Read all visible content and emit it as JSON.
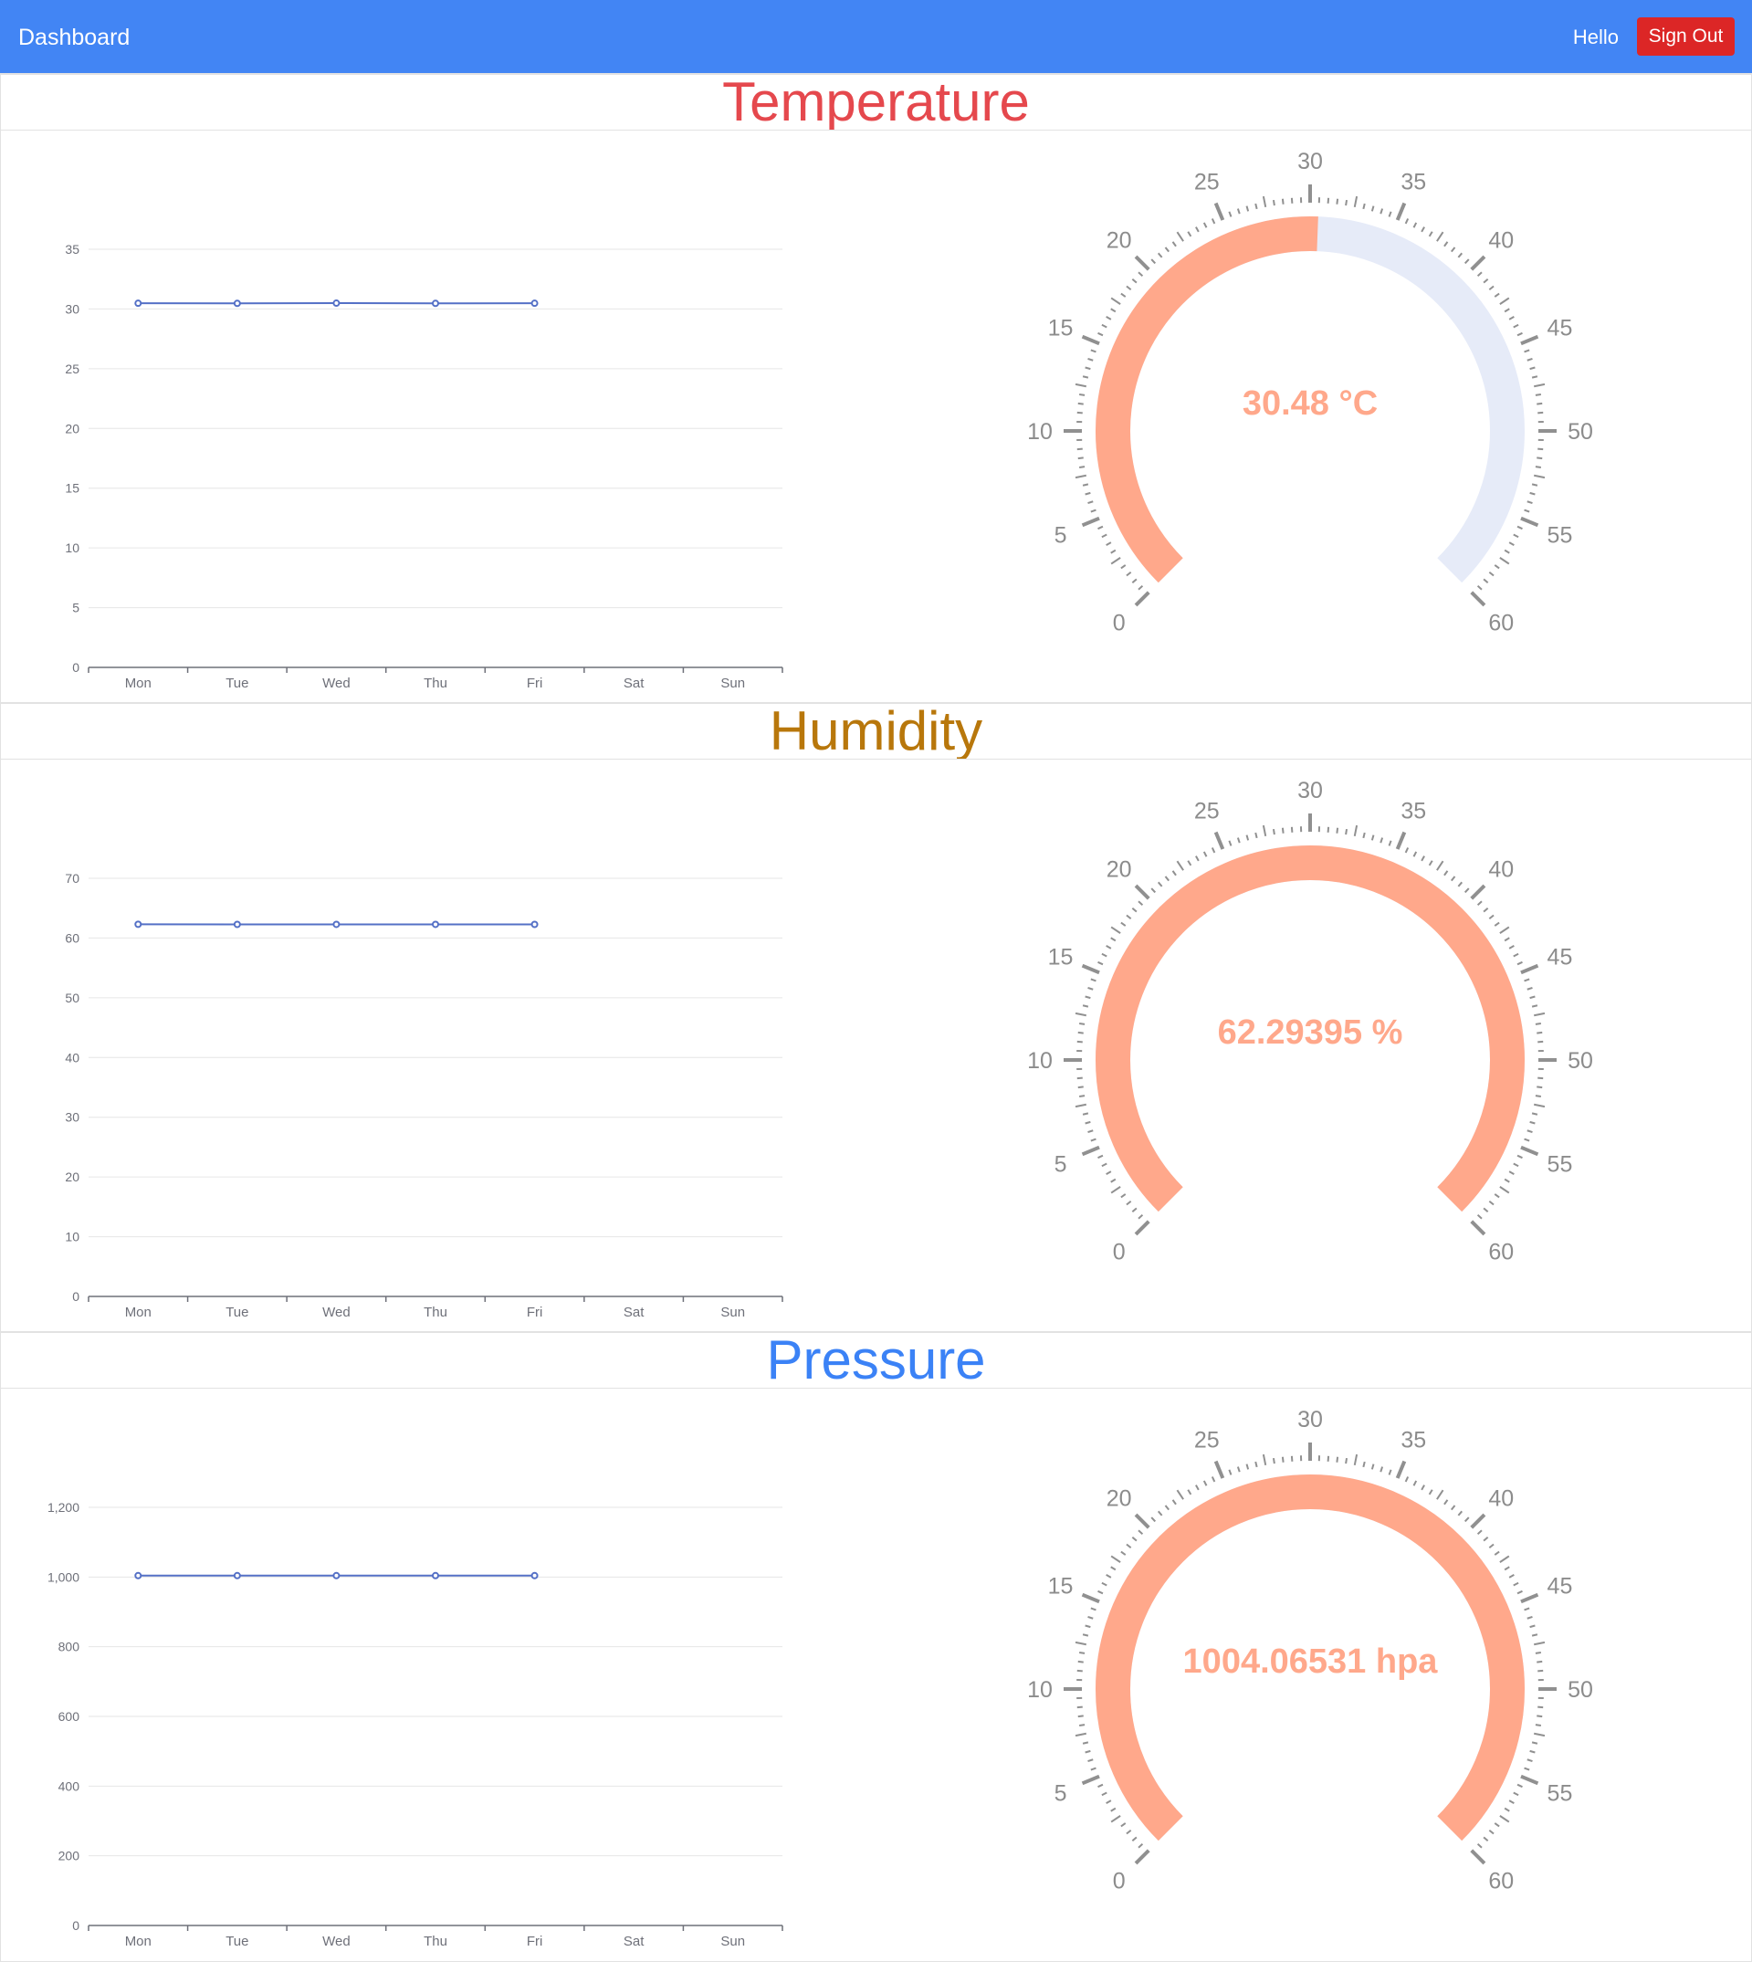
{
  "navbar": {
    "brand": "Dashboard",
    "greeting": "Hello",
    "sign_out_label": "Sign Out",
    "background": "#4285f4",
    "sign_out_color": "#dc2626"
  },
  "sections": [
    {
      "title": "Temperature",
      "title_color": "#e5484d",
      "gauge": {
        "label": "30.48 °C",
        "value": 30.48,
        "min": 0,
        "max": 60,
        "tick_labels": [
          "0",
          "5",
          "10",
          "15",
          "20",
          "25",
          "30",
          "35",
          "40",
          "45",
          "50",
          "55",
          "60"
        ],
        "progress_color": "#ffa88b",
        "track_color": "#e6ebf8"
      }
    },
    {
      "title": "Humidity",
      "title_color": "#b8770b",
      "gauge": {
        "label": "62.29395 %",
        "value": 62.29395,
        "min": 0,
        "max": 60,
        "tick_labels": [
          "0",
          "5",
          "10",
          "15",
          "20",
          "25",
          "30",
          "35",
          "40",
          "45",
          "50",
          "55",
          "60"
        ],
        "progress_color": "#ffa88b",
        "track_color": "#e6ebf8"
      }
    },
    {
      "title": "Pressure",
      "title_color": "#3b82f6",
      "gauge": {
        "label": "1004.06531 hpa",
        "value": 1004.06531,
        "min": 0,
        "max": 60,
        "tick_labels": [
          "0",
          "5",
          "10",
          "15",
          "20",
          "25",
          "30",
          "35",
          "40",
          "45",
          "50",
          "55",
          "60"
        ],
        "progress_color": "#ffa88b",
        "track_color": "#e6ebf8"
      }
    }
  ],
  "chart_data": [
    {
      "type": "line",
      "categories": [
        "Mon",
        "Tue",
        "Wed",
        "Thu",
        "Fri",
        "Sat",
        "Sun"
      ],
      "values": [
        30.48,
        30.47,
        30.49,
        30.47,
        30.48,
        null,
        null
      ],
      "ylim": [
        0,
        35
      ],
      "yticks": [
        0,
        5,
        10,
        15,
        20,
        25,
        30,
        35
      ],
      "ytick_labels": [
        "0",
        "5",
        "10",
        "15",
        "20",
        "25",
        "30",
        "35"
      ],
      "grid": true,
      "line_color": "#5470c6"
    },
    {
      "type": "line",
      "categories": [
        "Mon",
        "Tue",
        "Wed",
        "Thu",
        "Fri",
        "Sat",
        "Sun"
      ],
      "values": [
        62.3,
        62.28,
        62.29,
        62.29,
        62.28,
        null,
        null
      ],
      "ylim": [
        0,
        70
      ],
      "yticks": [
        0,
        10,
        20,
        30,
        40,
        50,
        60,
        70
      ],
      "ytick_labels": [
        "0",
        "10",
        "20",
        "30",
        "40",
        "50",
        "60",
        "70"
      ],
      "grid": true,
      "line_color": "#5470c6"
    },
    {
      "type": "line",
      "categories": [
        "Mon",
        "Tue",
        "Wed",
        "Thu",
        "Fri",
        "Sat",
        "Sun"
      ],
      "values": [
        1004.06,
        1004.07,
        1004.06,
        1004.06,
        1004.07,
        null,
        null
      ],
      "ylim": [
        0,
        1200
      ],
      "yticks": [
        0,
        200,
        400,
        600,
        800,
        1000,
        1200
      ],
      "ytick_labels": [
        "0",
        "200",
        "400",
        "600",
        "800",
        "1,000",
        "1,200"
      ],
      "grid": true,
      "line_color": "#5470c6"
    }
  ]
}
